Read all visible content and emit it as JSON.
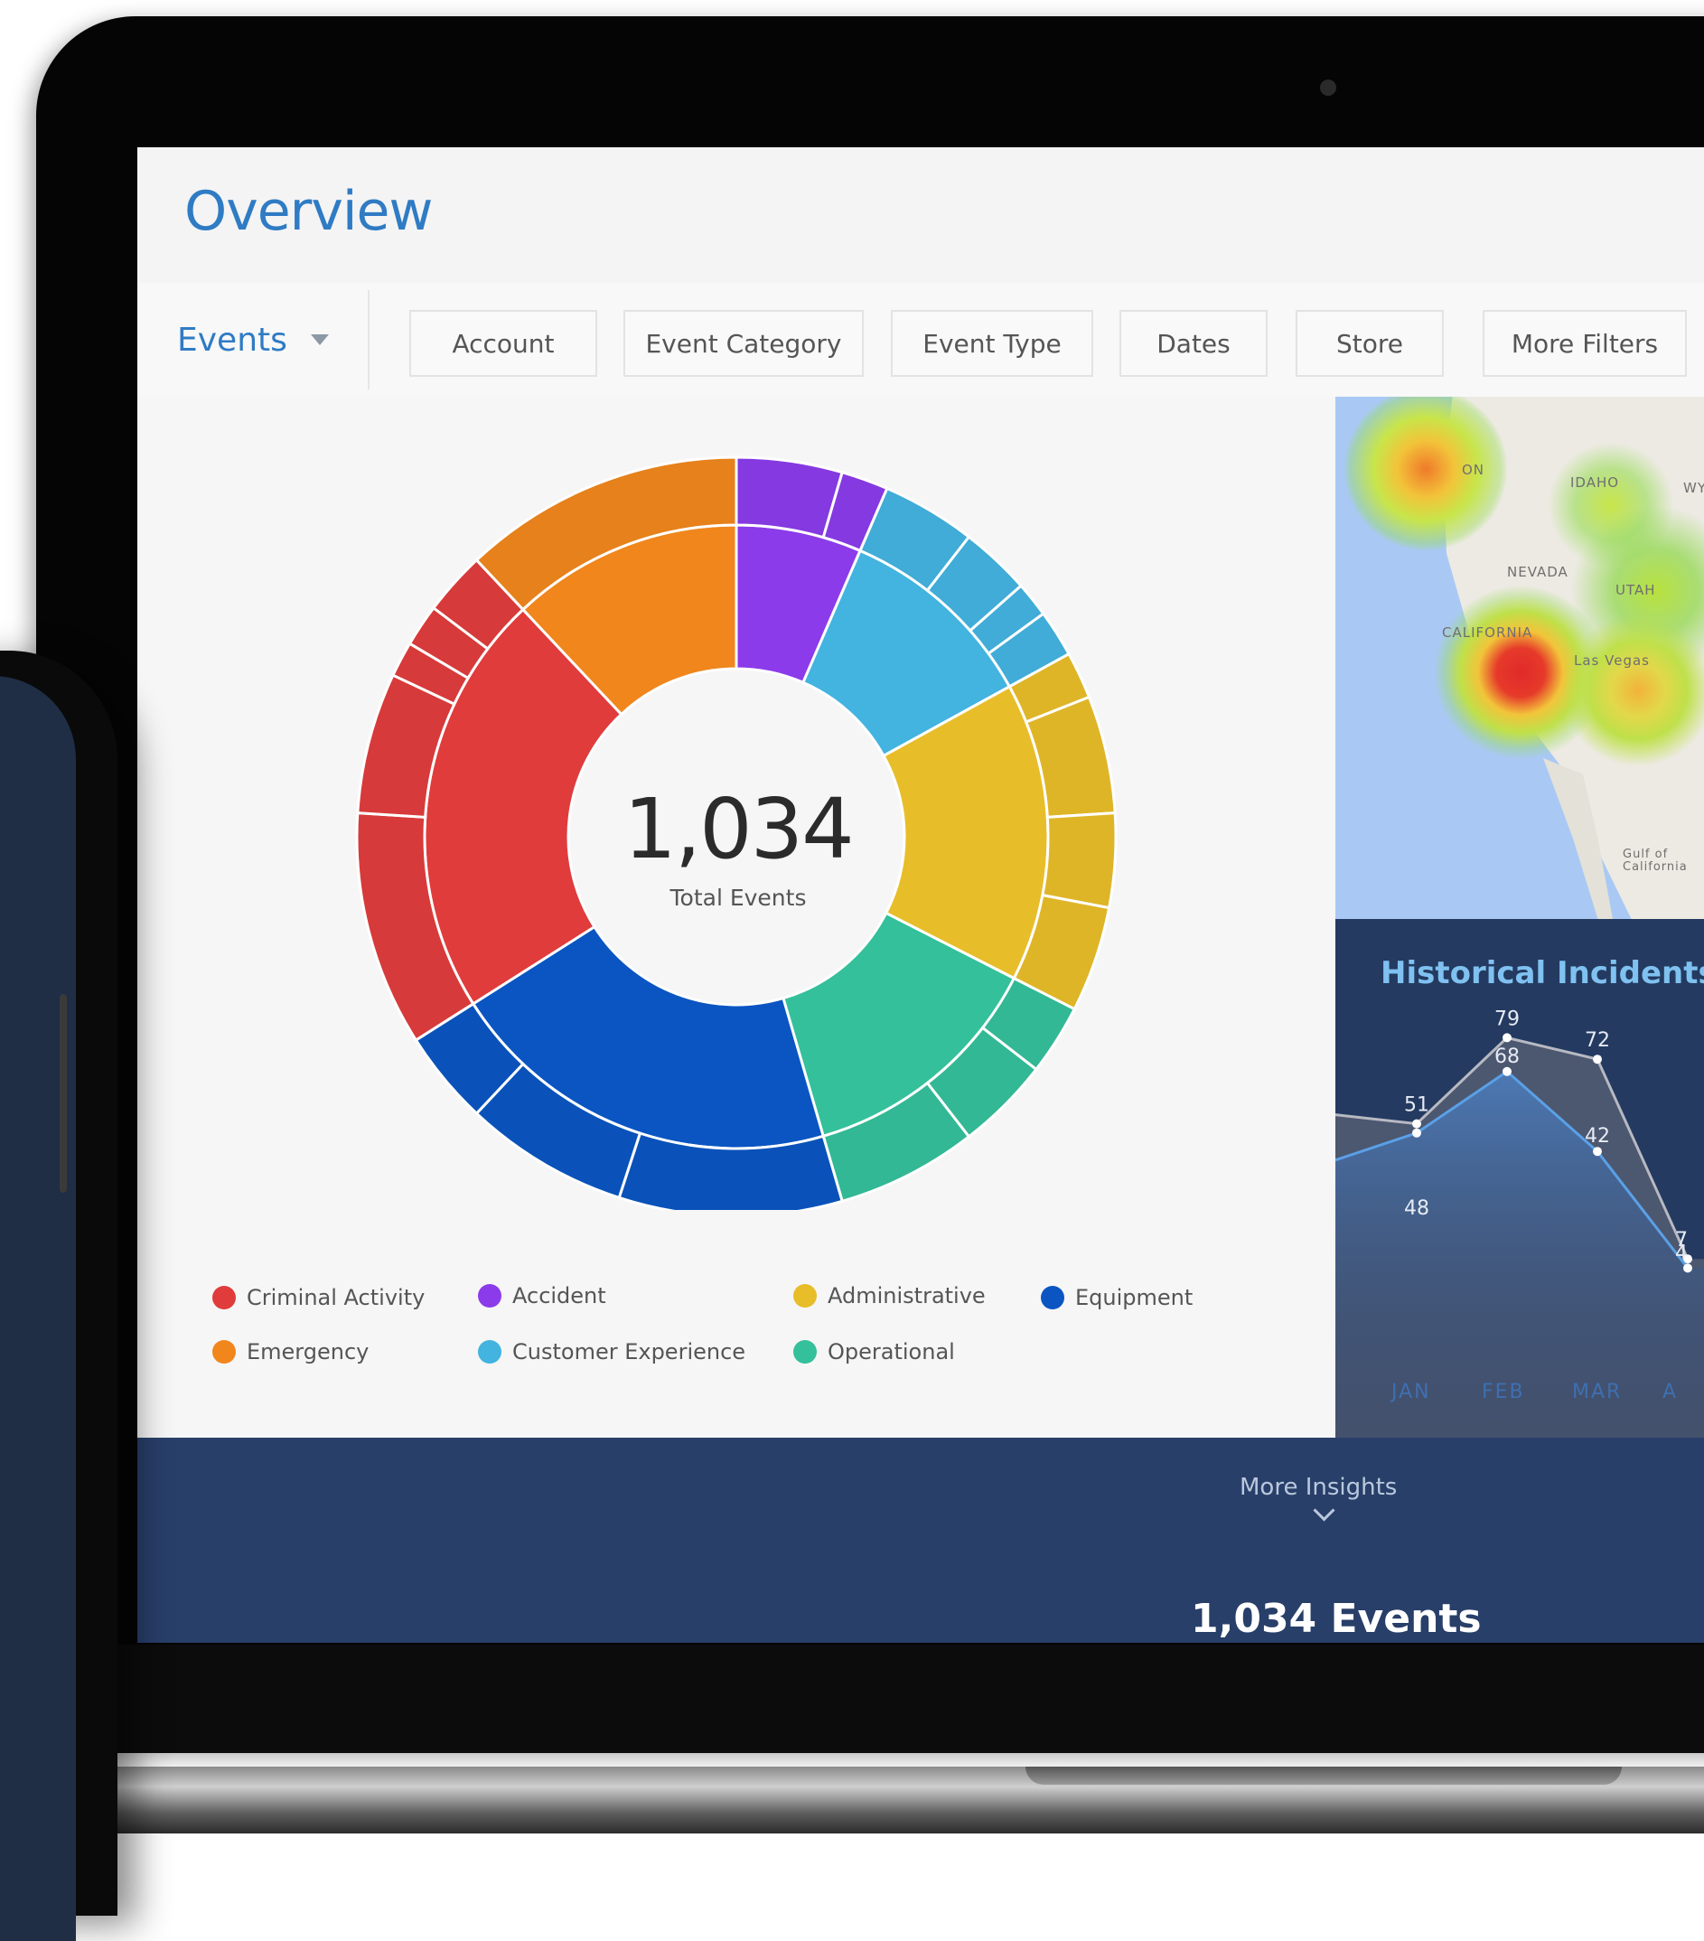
{
  "page": {
    "title": "Overview"
  },
  "filters": {
    "events_select": "Events",
    "buttons": [
      "Account",
      "Event Category",
      "Event Type",
      "Dates",
      "Store",
      "More Filters"
    ]
  },
  "donut": {
    "total": "1,034",
    "total_label": "Total Events",
    "categories": [
      {
        "name": "Accident",
        "color": "#8b3bea",
        "value": 6.5,
        "subs": [
          4.5,
          2.0
        ]
      },
      {
        "name": "Customer Experience",
        "color": "#43b3e0",
        "value": 10.5,
        "subs": [
          4.0,
          3.0,
          1.5,
          2.0
        ]
      },
      {
        "name": "Administrative",
        "color": "#e8bd2a",
        "value": 15.5,
        "subs": [
          2.0,
          5.0,
          4.0,
          4.5
        ]
      },
      {
        "name": "Operational",
        "color": "#34c09a",
        "value": 13.0,
        "subs": [
          3.0,
          4.0,
          6.0
        ]
      },
      {
        "name": "Equipment",
        "color": "#0a55c2",
        "value": 20.5,
        "subs": [
          9.5,
          7.0,
          4.0
        ]
      },
      {
        "name": "Criminal Activity",
        "color": "#e03c3c",
        "value": 22.0,
        "subs": [
          10.0,
          6.0,
          1.5,
          1.8,
          2.7
        ]
      },
      {
        "name": "Emergency",
        "color": "#f0861c",
        "value": 12.0,
        "subs": [
          12.0
        ]
      }
    ]
  },
  "legend": [
    {
      "label": "Criminal Activity",
      "color": "#e03c3c"
    },
    {
      "label": "Accident",
      "color": "#8b3bea"
    },
    {
      "label": "Administrative",
      "color": "#e8bd2a"
    },
    {
      "label": "Equipment",
      "color": "#0a55c2"
    },
    {
      "label": "Emergency",
      "color": "#f0861c"
    },
    {
      "label": "Customer Experience",
      "color": "#43b3e0"
    },
    {
      "label": "Operational",
      "color": "#34c09a"
    }
  ],
  "map": {
    "labels": [
      "ON",
      "IDAHO",
      "WY",
      "NEVADA",
      "UTAH",
      "CALIFORNIA",
      "Las Vegas",
      "Gulf of California"
    ]
  },
  "history": {
    "title": "Historical Incidents",
    "chart_data": {
      "type": "area",
      "categories": [
        "JAN",
        "FEB",
        "MAR",
        "A"
      ],
      "series": [
        {
          "values": [
            51,
            79,
            72,
            7
          ],
          "color": "#8a8f9c",
          "value_labels": [
            "51",
            "79",
            "72",
            "7"
          ]
        },
        {
          "values": [
            48,
            68,
            42,
            4
          ],
          "color": "#4d8ed3",
          "value_labels": [
            "48",
            "68",
            "42",
            "4"
          ]
        }
      ]
    }
  },
  "insights": {
    "link": "More Insights",
    "events_total": "1,034 Events"
  }
}
